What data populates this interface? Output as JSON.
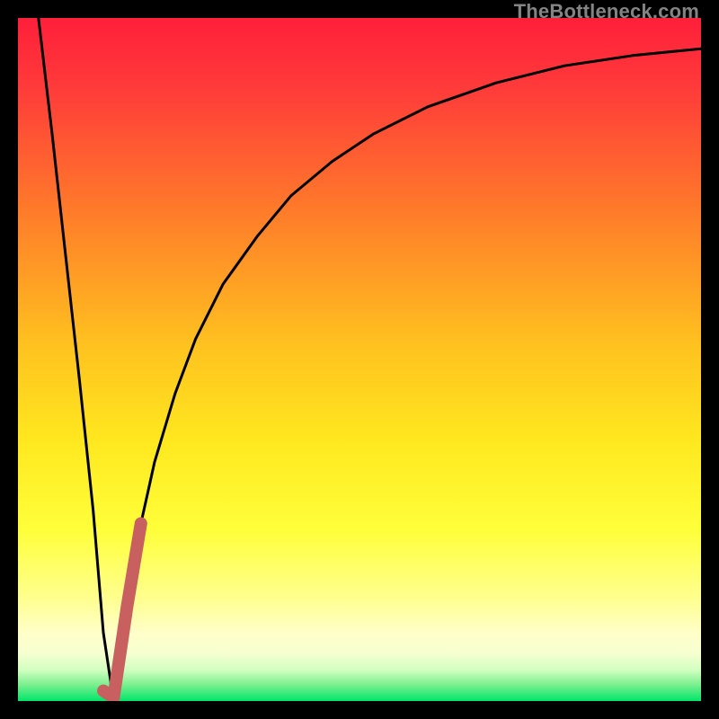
{
  "watermark": "TheBottleneck.com",
  "colors": {
    "gradient_top": "#ff1f3a",
    "gradient_mid1": "#ff7a2a",
    "gradient_mid2": "#ffd21f",
    "gradient_mid3": "#ffff3a",
    "gradient_pale": "#ffffb0",
    "gradient_bottom": "#00e66a",
    "curve_black": "#000000",
    "mark_red": "#c86060"
  },
  "chart_data": {
    "type": "line",
    "title": "",
    "xlabel": "",
    "ylabel": "",
    "xlim": [
      0,
      100
    ],
    "ylim": [
      0,
      100
    ],
    "grid": false,
    "series": [
      {
        "name": "bottleneck-curve",
        "x": [
          3,
          5,
          7,
          9,
          11,
          12.5,
          14,
          16,
          18,
          20,
          23,
          26,
          30,
          35,
          40,
          46,
          52,
          60,
          70,
          80,
          90,
          100
        ],
        "y": [
          100,
          83,
          65,
          47,
          28,
          10,
          0,
          14,
          26,
          35,
          45,
          53,
          61,
          68,
          74,
          79,
          83,
          87,
          90.5,
          93,
          94.5,
          95.5
        ]
      }
    ],
    "marked_segment": {
      "x": [
        12.5,
        14,
        16,
        18
      ],
      "y": [
        1.5,
        0.5,
        14,
        26
      ]
    },
    "annotations": []
  }
}
